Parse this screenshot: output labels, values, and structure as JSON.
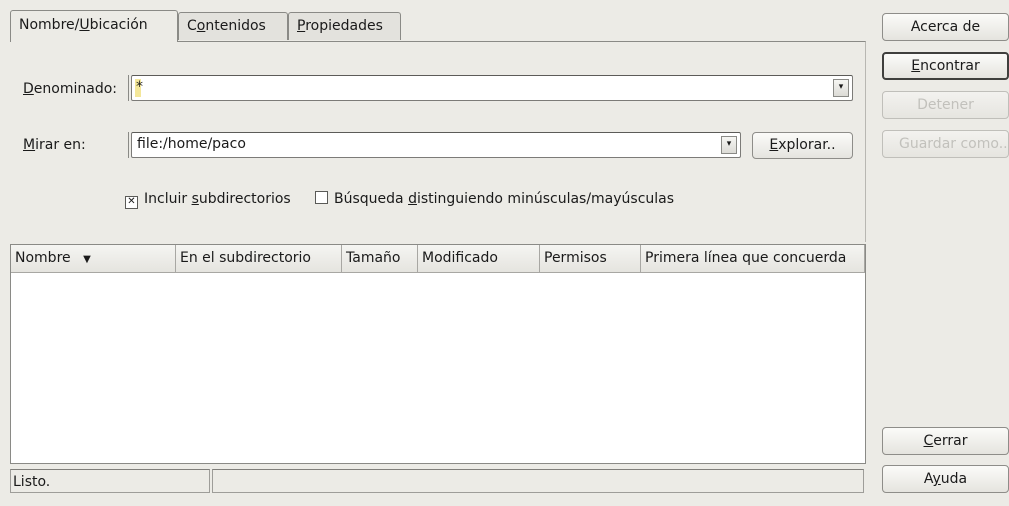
{
  "tabs": [
    {
      "pre": "Nombre/",
      "key": "U",
      "post": "bicación"
    },
    {
      "pre": "C",
      "key": "o",
      "post": "ntenidos"
    },
    {
      "pre": "",
      "key": "P",
      "post": "ropiedades"
    }
  ],
  "named": {
    "pre": "",
    "key": "D",
    "post": "enominado:",
    "value": "*"
  },
  "lookin": {
    "pre": "",
    "key": "M",
    "post": "irar en:",
    "value": "file:/home/paco"
  },
  "browse": {
    "pre": "",
    "key": "E",
    "post": "xplorar.."
  },
  "include_subdirs": {
    "pre": "Incluir ",
    "key": "s",
    "post": "ubdirectorios",
    "checked": true
  },
  "case_sensitive": {
    "pre": "Búsqueda ",
    "key": "d",
    "post": "istinguiendo minúsculas/mayúsculas",
    "checked": false
  },
  "columns": [
    "Nombre",
    "En el subdirectorio",
    "Tamaño",
    "Modificado",
    "Permisos",
    "Primera línea que concuerda"
  ],
  "buttons": {
    "about": {
      "pre": "Acerca de",
      "key": "",
      "post": ""
    },
    "find": {
      "pre": "",
      "key": "E",
      "post": "ncontrar"
    },
    "stop": {
      "pre": "Detener",
      "key": "",
      "post": ""
    },
    "save_as": {
      "pre": "Guardar como..",
      "key": "",
      "post": ""
    },
    "close": {
      "pre": "",
      "key": "C",
      "post": "errar"
    },
    "help": {
      "pre": "A",
      "key": "y",
      "post": "uda"
    }
  },
  "status": {
    "text": "Listo.",
    "secondary": ""
  }
}
